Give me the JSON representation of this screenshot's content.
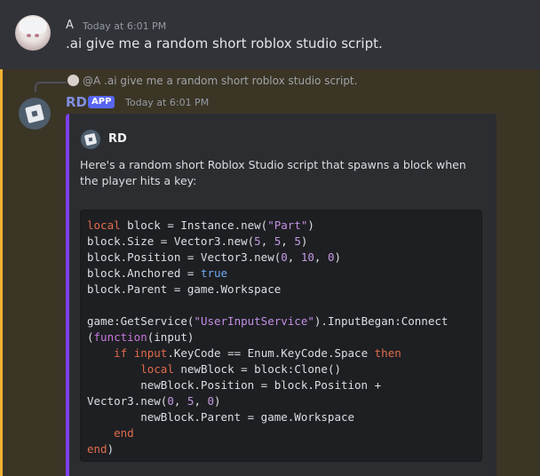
{
  "message1": {
    "author": "A",
    "timestamp": "Today at 6:01 PM",
    "text": ".ai give me a random short roblox studio script."
  },
  "message2": {
    "reply_author": "@A",
    "reply_text": ".ai give me a random short roblox studio script.",
    "author": "RD",
    "badge": "APP",
    "timestamp": "Today at 6:01 PM",
    "embed": {
      "author": "RD",
      "description": "Here's a random short Roblox Studio script that spawns a block when the player hits a key:",
      "code_lines": [
        "local block = Instance.new(\"Part\")",
        "block.Size = Vector3.new(5, 5, 5)",
        "block.Position = Vector3.new(0, 10, 0)",
        "block.Anchored = true",
        "block.Parent = game.Workspace",
        "",
        "game:GetService(\"UserInputService\").InputBegan:Connect",
        "(function(input)",
        "    if input.KeyCode == Enum.KeyCode.Space then",
        "        local newBlock = block:Clone()",
        "        newBlock.Position = block.Position +",
        "Vector3.new(0, 5, 0)",
        "        newBlock.Parent = game.Workspace",
        "    end",
        "end)"
      ]
    }
  },
  "colors": {
    "background": "#313338",
    "mention_highlight": "#3b3526",
    "mention_bar": "#f0b232",
    "embed_bar": "#7b3ff2",
    "bot_name": "#7f8fe0",
    "badge": "#5865f2"
  }
}
